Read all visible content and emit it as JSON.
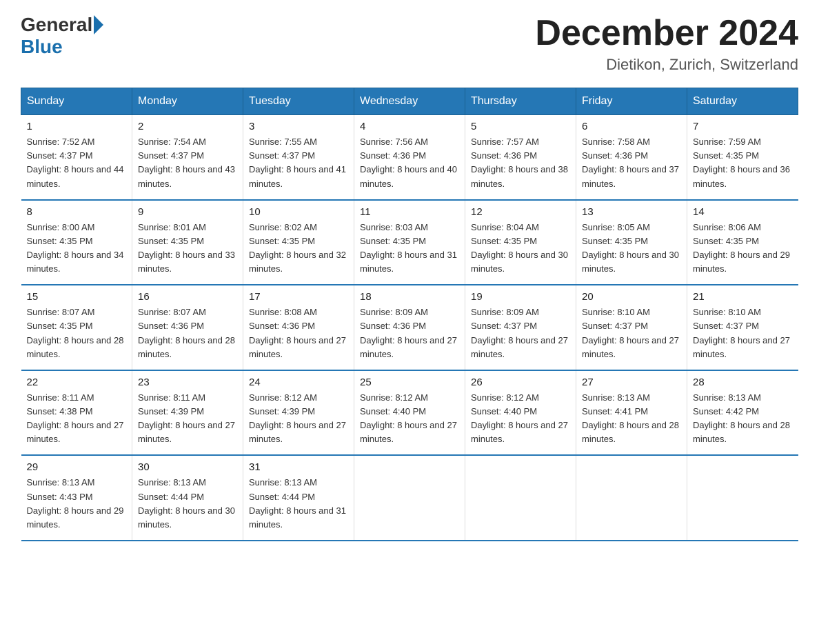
{
  "header": {
    "logo_general": "General",
    "logo_blue": "Blue",
    "month_title": "December 2024",
    "location": "Dietikon, Zurich, Switzerland"
  },
  "days_of_week": [
    "Sunday",
    "Monday",
    "Tuesday",
    "Wednesday",
    "Thursday",
    "Friday",
    "Saturday"
  ],
  "weeks": [
    [
      {
        "day": "1",
        "sunrise": "7:52 AM",
        "sunset": "4:37 PM",
        "daylight": "8 hours and 44 minutes."
      },
      {
        "day": "2",
        "sunrise": "7:54 AM",
        "sunset": "4:37 PM",
        "daylight": "8 hours and 43 minutes."
      },
      {
        "day": "3",
        "sunrise": "7:55 AM",
        "sunset": "4:37 PM",
        "daylight": "8 hours and 41 minutes."
      },
      {
        "day": "4",
        "sunrise": "7:56 AM",
        "sunset": "4:36 PM",
        "daylight": "8 hours and 40 minutes."
      },
      {
        "day": "5",
        "sunrise": "7:57 AM",
        "sunset": "4:36 PM",
        "daylight": "8 hours and 38 minutes."
      },
      {
        "day": "6",
        "sunrise": "7:58 AM",
        "sunset": "4:36 PM",
        "daylight": "8 hours and 37 minutes."
      },
      {
        "day": "7",
        "sunrise": "7:59 AM",
        "sunset": "4:35 PM",
        "daylight": "8 hours and 36 minutes."
      }
    ],
    [
      {
        "day": "8",
        "sunrise": "8:00 AM",
        "sunset": "4:35 PM",
        "daylight": "8 hours and 34 minutes."
      },
      {
        "day": "9",
        "sunrise": "8:01 AM",
        "sunset": "4:35 PM",
        "daylight": "8 hours and 33 minutes."
      },
      {
        "day": "10",
        "sunrise": "8:02 AM",
        "sunset": "4:35 PM",
        "daylight": "8 hours and 32 minutes."
      },
      {
        "day": "11",
        "sunrise": "8:03 AM",
        "sunset": "4:35 PM",
        "daylight": "8 hours and 31 minutes."
      },
      {
        "day": "12",
        "sunrise": "8:04 AM",
        "sunset": "4:35 PM",
        "daylight": "8 hours and 30 minutes."
      },
      {
        "day": "13",
        "sunrise": "8:05 AM",
        "sunset": "4:35 PM",
        "daylight": "8 hours and 30 minutes."
      },
      {
        "day": "14",
        "sunrise": "8:06 AM",
        "sunset": "4:35 PM",
        "daylight": "8 hours and 29 minutes."
      }
    ],
    [
      {
        "day": "15",
        "sunrise": "8:07 AM",
        "sunset": "4:35 PM",
        "daylight": "8 hours and 28 minutes."
      },
      {
        "day": "16",
        "sunrise": "8:07 AM",
        "sunset": "4:36 PM",
        "daylight": "8 hours and 28 minutes."
      },
      {
        "day": "17",
        "sunrise": "8:08 AM",
        "sunset": "4:36 PM",
        "daylight": "8 hours and 27 minutes."
      },
      {
        "day": "18",
        "sunrise": "8:09 AM",
        "sunset": "4:36 PM",
        "daylight": "8 hours and 27 minutes."
      },
      {
        "day": "19",
        "sunrise": "8:09 AM",
        "sunset": "4:37 PM",
        "daylight": "8 hours and 27 minutes."
      },
      {
        "day": "20",
        "sunrise": "8:10 AM",
        "sunset": "4:37 PM",
        "daylight": "8 hours and 27 minutes."
      },
      {
        "day": "21",
        "sunrise": "8:10 AM",
        "sunset": "4:37 PM",
        "daylight": "8 hours and 27 minutes."
      }
    ],
    [
      {
        "day": "22",
        "sunrise": "8:11 AM",
        "sunset": "4:38 PM",
        "daylight": "8 hours and 27 minutes."
      },
      {
        "day": "23",
        "sunrise": "8:11 AM",
        "sunset": "4:39 PM",
        "daylight": "8 hours and 27 minutes."
      },
      {
        "day": "24",
        "sunrise": "8:12 AM",
        "sunset": "4:39 PM",
        "daylight": "8 hours and 27 minutes."
      },
      {
        "day": "25",
        "sunrise": "8:12 AM",
        "sunset": "4:40 PM",
        "daylight": "8 hours and 27 minutes."
      },
      {
        "day": "26",
        "sunrise": "8:12 AM",
        "sunset": "4:40 PM",
        "daylight": "8 hours and 27 minutes."
      },
      {
        "day": "27",
        "sunrise": "8:13 AM",
        "sunset": "4:41 PM",
        "daylight": "8 hours and 28 minutes."
      },
      {
        "day": "28",
        "sunrise": "8:13 AM",
        "sunset": "4:42 PM",
        "daylight": "8 hours and 28 minutes."
      }
    ],
    [
      {
        "day": "29",
        "sunrise": "8:13 AM",
        "sunset": "4:43 PM",
        "daylight": "8 hours and 29 minutes."
      },
      {
        "day": "30",
        "sunrise": "8:13 AM",
        "sunset": "4:44 PM",
        "daylight": "8 hours and 30 minutes."
      },
      {
        "day": "31",
        "sunrise": "8:13 AM",
        "sunset": "4:44 PM",
        "daylight": "8 hours and 31 minutes."
      },
      null,
      null,
      null,
      null
    ]
  ],
  "labels": {
    "sunrise": "Sunrise:",
    "sunset": "Sunset:",
    "daylight": "Daylight:"
  }
}
